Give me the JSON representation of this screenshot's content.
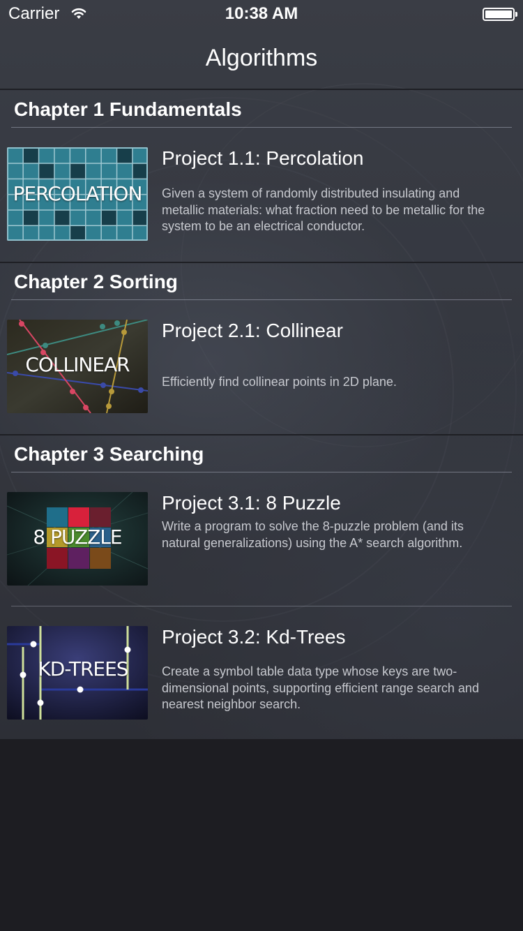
{
  "status_bar": {
    "carrier": "Carrier",
    "time": "10:38 AM",
    "wifi_icon": "wifi-icon",
    "battery_icon": "battery-icon"
  },
  "nav": {
    "title": "Algorithms"
  },
  "chapters": [
    {
      "title": "Chapter 1 Fundamentals",
      "projects": [
        {
          "title": "Project 1.1: Percolation",
          "description": "Given a system of randomly distributed insulating and metallic materials: what fraction need to be metallic for the system to be an electrical conductor.",
          "thumb_label": "PERCOLATION"
        }
      ]
    },
    {
      "title": "Chapter 2 Sorting",
      "projects": [
        {
          "title": "Project 2.1: Collinear",
          "description": "Efficiently find collinear points in 2D plane.",
          "thumb_label": "COLLINEAR"
        }
      ]
    },
    {
      "title": "Chapter 3 Searching",
      "projects": [
        {
          "title": "Project 3.1: 8 Puzzle",
          "description": "Write a program to solve the 8-puzzle problem (and its natural generalizations) using the A* search algorithm.",
          "thumb_label": "8 PUZZLE"
        },
        {
          "title": "Project 3.2: Kd-Trees",
          "description": "Create a symbol table data type whose keys are two-dimensional points, supporting efficient range search and nearest neighbor search.",
          "thumb_label": "KD-TREES"
        }
      ]
    }
  ],
  "colors": {
    "background": "#2f3138",
    "separator": "#1e1f24",
    "description_text": "#c7c9cf",
    "percolation_teal": "#2f7e90",
    "percolation_dark": "#173e4a"
  }
}
